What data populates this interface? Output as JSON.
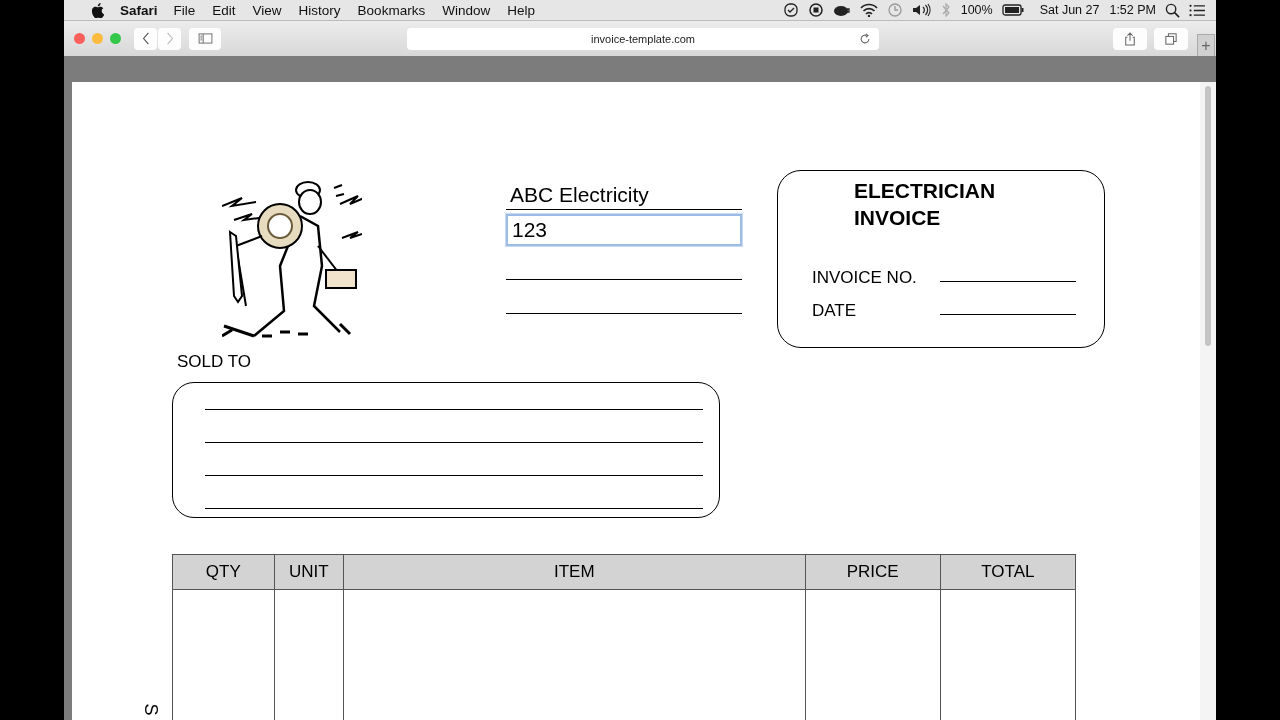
{
  "menu_bar": {
    "app": "Safari",
    "menus": [
      "File",
      "Edit",
      "View",
      "History",
      "Bookmarks",
      "Window",
      "Help"
    ],
    "battery": "100%",
    "date": "Sat Jun 27",
    "time": "1:52 PM"
  },
  "toolbar": {
    "address": "invoice-template.com",
    "new_tab": "+"
  },
  "invoice": {
    "company_fields": [
      {
        "value": "ABC Electricity",
        "focused": false
      },
      {
        "value": "123",
        "focused": true
      },
      {
        "focused": false
      },
      {
        "focused": false
      }
    ],
    "title_lines": [
      "ELECTRICIAN",
      "INVOICE"
    ],
    "meta_fields": [
      {
        "label": "INVOICE NO."
      },
      {
        "label": "DATE"
      }
    ],
    "sold_to_label": "SOLD TO",
    "sold_to_fields": [
      {
        "focused": false
      },
      {
        "focused": false
      },
      {
        "focused": false
      },
      {
        "focused": false
      }
    ],
    "table": {
      "columns": [
        "QTY",
        "UNIT",
        "ITEM",
        "PRICE",
        "TOTAL"
      ]
    },
    "side_text": "S"
  }
}
